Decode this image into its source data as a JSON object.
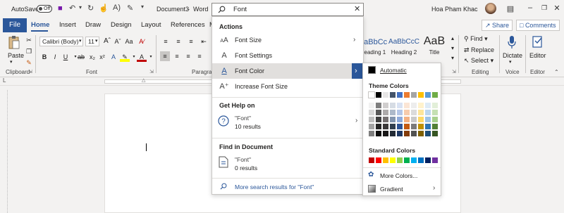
{
  "titlebar": {
    "autosave_label": "AutoSave",
    "toggle_state": "Off",
    "doc_title": "Document3",
    "separator": "-",
    "app_name": "Word",
    "user_name": "Hoa Pham Khac",
    "search_value": "Font"
  },
  "tabs": [
    "File",
    "Home",
    "Insert",
    "Draw",
    "Design",
    "Layout",
    "References",
    "M"
  ],
  "ribbon": {
    "share_label": "Share",
    "comments_label": "Comments",
    "paste_label": "Paste",
    "font_name": "Calibri (Body)",
    "font_size": "11",
    "groups": {
      "clipboard": "Clipboard",
      "font": "Font",
      "paragraph": "Paragraph",
      "editing": "Editing",
      "voice": "Voice",
      "editor": "Editor"
    },
    "styles": [
      {
        "sample": "AaBbCc",
        "name": "Heading 1"
      },
      {
        "sample": "AaBbCcC",
        "name": "Heading 2"
      },
      {
        "sample": "AaB",
        "name": "Title"
      }
    ],
    "find_label": "Find",
    "replace_label": "Replace",
    "select_label": "Select",
    "dictate_label": "Dictate",
    "editor_label": "Editor"
  },
  "dropdown": {
    "actions_header": "Actions",
    "actions": [
      {
        "icon": "font-size-icon",
        "label": "Font Size",
        "has_submenu": true
      },
      {
        "icon": "font-settings-icon",
        "label": "Font Settings",
        "has_submenu": false
      },
      {
        "icon": "font-color-icon",
        "label": "Font Color",
        "has_submenu": true,
        "highlighted": true
      },
      {
        "icon": "increase-font-size-icon",
        "label": "Increase Font Size",
        "has_submenu": false
      }
    ],
    "help_header": "Get Help on",
    "help_item": {
      "title": "\"Font\"",
      "subtitle": "10 results"
    },
    "find_header": "Find in Document",
    "find_item": {
      "title": "\"Font\"",
      "subtitle": "0 results"
    },
    "more_results": "More search results for \"Font\""
  },
  "color_flyout": {
    "automatic_label": "Automatic",
    "theme_header": "Theme Colors",
    "standard_header": "Standard Colors",
    "more_colors": "More Colors...",
    "gradient": "Gradient",
    "theme_colors": [
      [
        "#ffffff",
        "#000000",
        "#e7e6e6",
        "#44546a",
        "#4472c4",
        "#ed7d31",
        "#a5a5a5",
        "#ffc000",
        "#5b9bd5",
        "#70ad47"
      ],
      [
        "#f2f2f2",
        "#7f7f7f",
        "#d0cece",
        "#d6dce4",
        "#d9e2f3",
        "#fbe5d5",
        "#ededed",
        "#fff2cc",
        "#deebf6",
        "#e2efd9"
      ],
      [
        "#d8d8d8",
        "#595959",
        "#aeabab",
        "#adb9ca",
        "#b4c6e7",
        "#f7cbac",
        "#dbdbdb",
        "#fee599",
        "#bdd7ee",
        "#c5e0b3"
      ],
      [
        "#bfbfbf",
        "#3f3f3f",
        "#757070",
        "#8496b0",
        "#8eaadb",
        "#f4b183",
        "#c9c9c9",
        "#ffd965",
        "#9dc3e6",
        "#a8d08d"
      ],
      [
        "#a5a5a5",
        "#262626",
        "#3a3838",
        "#323f4f",
        "#2f5496",
        "#c55a11",
        "#7b7b7b",
        "#bf9000",
        "#2e75b5",
        "#538135"
      ],
      [
        "#7f7f7f",
        "#0c0c0c",
        "#171616",
        "#222a35",
        "#1e3864",
        "#833c0b",
        "#525252",
        "#7f6000",
        "#1e4e79",
        "#375623"
      ]
    ],
    "standard_colors": [
      "#c00000",
      "#ff0000",
      "#ffc000",
      "#ffff00",
      "#92d050",
      "#00b050",
      "#00b0f0",
      "#0070c0",
      "#002060",
      "#7030a0"
    ]
  }
}
